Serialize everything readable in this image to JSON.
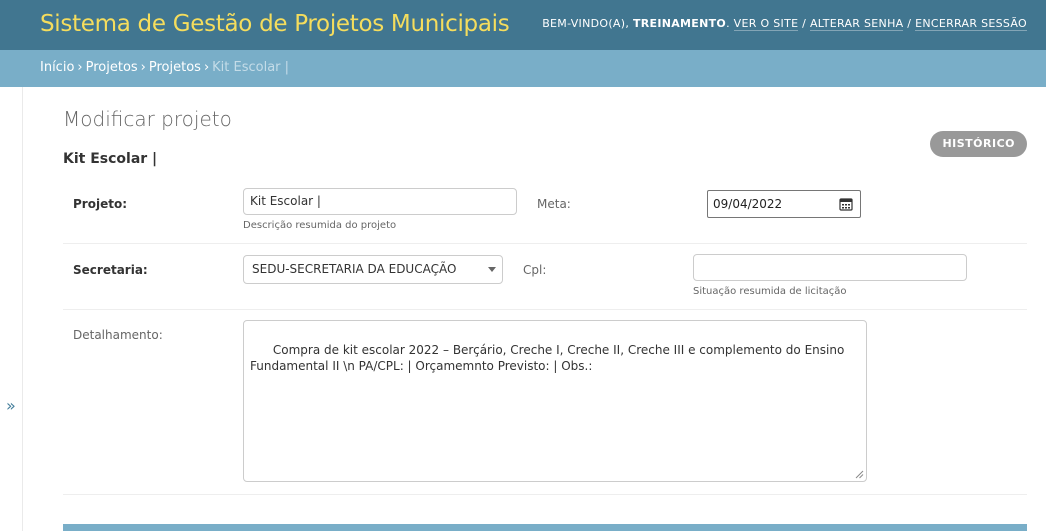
{
  "header": {
    "site_title": "Sistema de Gestão de Projetos Municipais",
    "welcome": "BEM-VINDO(A),",
    "user": "TREINAMENTO",
    "view_site": "VER O SITE",
    "change_password": "ALTERAR SENHA",
    "logout": "ENCERRAR SESSÃO",
    "sep1": "/",
    "sep2": "/"
  },
  "breadcrumbs": {
    "items": [
      "Início",
      "Projetos",
      "Projetos"
    ],
    "current": "Kit Escolar |",
    "separator": "›"
  },
  "sidebar_toggle": {
    "glyph": "»"
  },
  "page": {
    "title": "Modificar projeto",
    "object_name": "Kit Escolar |",
    "history_button": "HISTÓRICO"
  },
  "form": {
    "projeto": {
      "label": "Projeto:",
      "value": "Kit Escolar |",
      "help": "Descrição resumida do projeto"
    },
    "meta": {
      "label": "Meta:",
      "value": "09/04/2022",
      "icon": "calendar-icon"
    },
    "secretaria": {
      "label": "Secretaria:",
      "value": "SEDU-SECRETARIA DA EDUCAÇÃO",
      "icon": "dropdown-arrow-icon"
    },
    "cpl": {
      "label": "Cpl:",
      "value": "",
      "help": "Situação resumida de licitação"
    },
    "detalhamento": {
      "label": "Detalhamento:",
      "value": "Compra de kit escolar 2022 – Berçário, Creche I, Creche II, Creche III e complemento do Ensino Fundamental II \\n PA/CPL: | Orçamemnto Previsto: | Obs.:"
    }
  },
  "colors": {
    "header_bg": "#417690",
    "site_title": "#f5dd5d",
    "breadcrumbs_bg": "#79aec8",
    "history_button_bg": "#999999"
  }
}
